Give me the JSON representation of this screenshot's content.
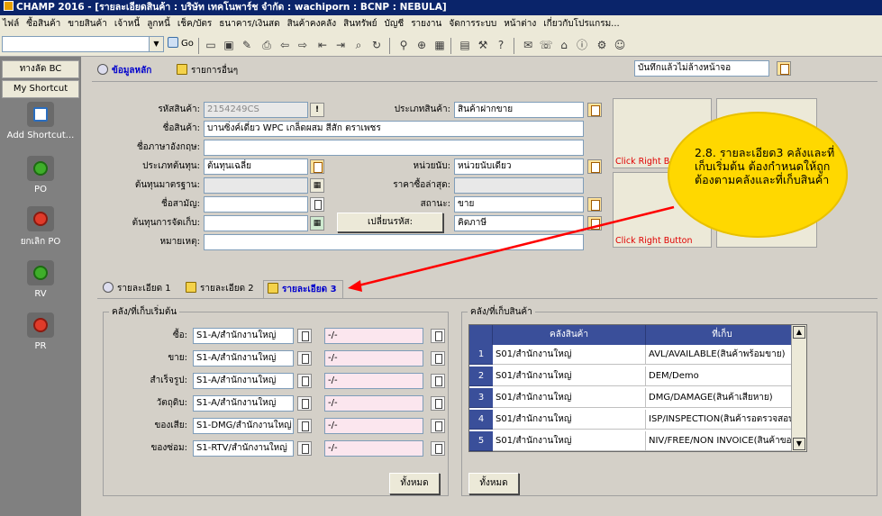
{
  "window": {
    "title": "CHAMP 2016 - [รายละเอียดสินค้า : บริษัท เทคโนพาร์ช จำกัด : wachiporn : BCNP : NEBULA]"
  },
  "menu": [
    "ไฟล์",
    "ซื้อสินค้า",
    "ขายสินค้า",
    "เจ้าหนี้",
    "ลูกหนี้",
    "เช็ค/บัตร",
    "ธนาคาร/เงินสด",
    "สินค้าคงคลัง",
    "สินทรัพย์",
    "บัญชี",
    "รายงาน",
    "จัดการระบบ",
    "หน้าต่าง",
    "เกี่ยวกับโปรแกรม..."
  ],
  "toolbar": {
    "combo_value": "",
    "go_label": "Go",
    "icons": [
      "new-icon",
      "save-icon",
      "edit-icon",
      "print-icon",
      "back-icon",
      "forward-icon",
      "first-icon",
      "last-icon",
      "search-icon",
      "refresh-icon",
      "find-icon",
      "zoom-icon",
      "grid-icon",
      "calc-icon",
      "tools-icon",
      "help-icon",
      "mail-icon",
      "phone-icon",
      "home-icon",
      "info-icon",
      "settings-icon",
      "user-icon"
    ]
  },
  "sidebar": {
    "tabs": [
      "ทางลัด BC",
      "My Shortcut"
    ],
    "items": [
      {
        "label": "Add Shortcut...",
        "icon": "add-shortcut-icon"
      },
      {
        "label": "PO",
        "icon": "po-icon"
      },
      {
        "label": "ยกเลิก PO",
        "icon": "cancel-po-icon"
      },
      {
        "label": "RV",
        "icon": "rv-icon"
      },
      {
        "label": "PR",
        "icon": "pr-icon"
      }
    ]
  },
  "top_tabs": [
    "ข้อมูลหลัก",
    "รายการอื่นๆ"
  ],
  "save_mode": {
    "value": "บันทึกแล้วไม่ล้างหน้าจอ"
  },
  "form": {
    "code_label": "รหัสสินค้า:",
    "code_value": "2154249CS",
    "type_label": "ประเภทสินค้า:",
    "type_value": "สินค้าฝากขาย",
    "name_label": "ชื่อสินค้า:",
    "name_value": "บานซิ่งค์เดี่ยว WPC เกล็ดผสม สีสัก ตราเพชร",
    "eng_label": "ชื่อภาษาอังกฤษ:",
    "eng_value": "",
    "costtype_label": "ประเภทต้นทุน:",
    "costtype_value": "ต้นทุนเฉลี่ย",
    "unit_label": "หน่วยนับ:",
    "unit_value": "หน่วยนับเดียว",
    "stdcost_label": "ต้นทุนมาตรฐาน:",
    "stdcost_value": "",
    "lastbuy_label": "ราคาซื้อล่าสุด:",
    "lastbuy_value": "",
    "common_label": "ชื่อสามัญ:",
    "common_value": "",
    "status_label": "สถานะ:",
    "status_value": "ขาย",
    "storecost_label": "ต้นทุนการจัดเก็บ:",
    "storecost_value": "",
    "change_code_label": "เปลี่ยนรหัส:",
    "change_code_value": "คิดภาษี",
    "note_label": "หมายเหตุ:",
    "note_value": ""
  },
  "image_boxes": [
    "Click Right Butt",
    "Click Right Button",
    "",
    ""
  ],
  "detail_tabs": [
    "รายละเอียด 1",
    "รายละเอียด 2",
    "รายละเอียด 3"
  ],
  "start_group": {
    "legend": "คลัง/ที่เก็บเริ่มต้น",
    "rows": [
      {
        "label": "ซื้อ:",
        "wh": "S1-A/สำนักงานใหญ่",
        "loc": "-/-"
      },
      {
        "label": "ขาย:",
        "wh": "S1-A/สำนักงานใหญ่",
        "loc": "-/-"
      },
      {
        "label": "สำเร็จรูป:",
        "wh": "S1-A/สำนักงานใหญ่",
        "loc": "-/-"
      },
      {
        "label": "วัตถุดิบ:",
        "wh": "S1-A/สำนักงานใหญ่",
        "loc": "-/-"
      },
      {
        "label": "ของเสีย:",
        "wh": "S1-DMG/สำนักงานใหญ่",
        "loc": "-/-"
      },
      {
        "label": "ของซ่อม:",
        "wh": "S1-RTV/สำนักงานใหญ่",
        "loc": "-/-"
      }
    ],
    "all_button": "ทั้งหมด"
  },
  "stock_group": {
    "legend": "คลัง/ที่เก็บสินค้า",
    "columns": [
      "คลังสินค้า",
      "ที่เก็บ"
    ],
    "rows": [
      {
        "num": "1",
        "wh": "S01/สำนักงานใหญ่",
        "loc": "AVL/AVAILABLE(สินค้าพร้อมขาย)"
      },
      {
        "num": "2",
        "wh": "S01/สำนักงานใหญ่",
        "loc": "DEM/Demo"
      },
      {
        "num": "3",
        "wh": "S01/สำนักงานใหญ่",
        "loc": "DMG/DAMAGE(สินค้าเสียหาย)"
      },
      {
        "num": "4",
        "wh": "S01/สำนักงานใหญ่",
        "loc": "ISP/INSPECTION(สินค้ารอตรวจสอบ)"
      },
      {
        "num": "5",
        "wh": "S01/สำนักงานใหญ่",
        "loc": "NIV/FREE/NON INVOICE(สินค้าของแ"
      }
    ],
    "all_button": "ทั้งหมด"
  },
  "annotation": {
    "text": "2.8. รายละเอียด3 คลังและที่เก็บเริ่มต้น ต้องกำหนดให้ถูกต้องตามคลังและที่เก็บสินค้า",
    "color": "#ffd800",
    "arrow_color": "#ff0000"
  }
}
